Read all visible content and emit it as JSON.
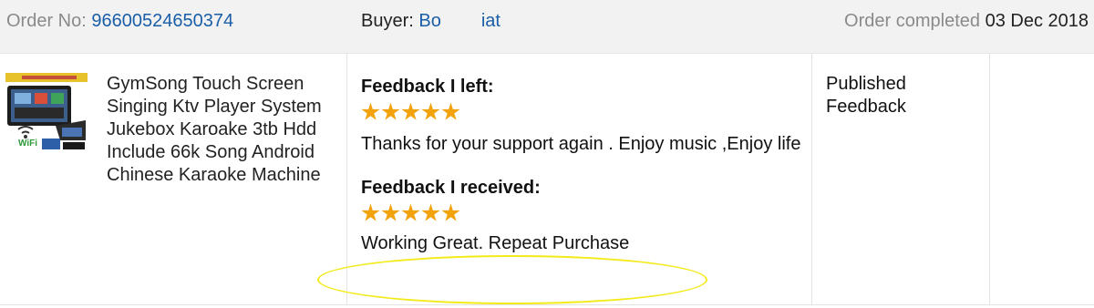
{
  "header": {
    "order_label": "Order No:",
    "order_number": "96600524650374",
    "buyer_label": "Buyer:",
    "buyer_name_start": "Bo",
    "buyer_name_end": "iat",
    "status_label": "Order completed",
    "status_date": "03 Dec 2018"
  },
  "product": {
    "title": "GymSong Touch Screen Singing Ktv Player System Jukebox Karoake 3tb Hdd Include 66k Song Android Chinese Karaoke Machine",
    "thumbnail_badge": "WiFi"
  },
  "feedback_left": {
    "heading": "Feedback I left:",
    "rating": 5,
    "text": "Thanks for your support again . Enjoy music ,Enjoy life"
  },
  "feedback_received": {
    "heading": "Feedback I received:",
    "rating": 5,
    "text": "Working Great. Repeat Purchase"
  },
  "status": {
    "text": "Published Feedback"
  },
  "colors": {
    "link": "#1a5ea8",
    "star": "#f2a20c",
    "highlight": "#f3ea1a",
    "header_bg": "#f2f2f2"
  }
}
